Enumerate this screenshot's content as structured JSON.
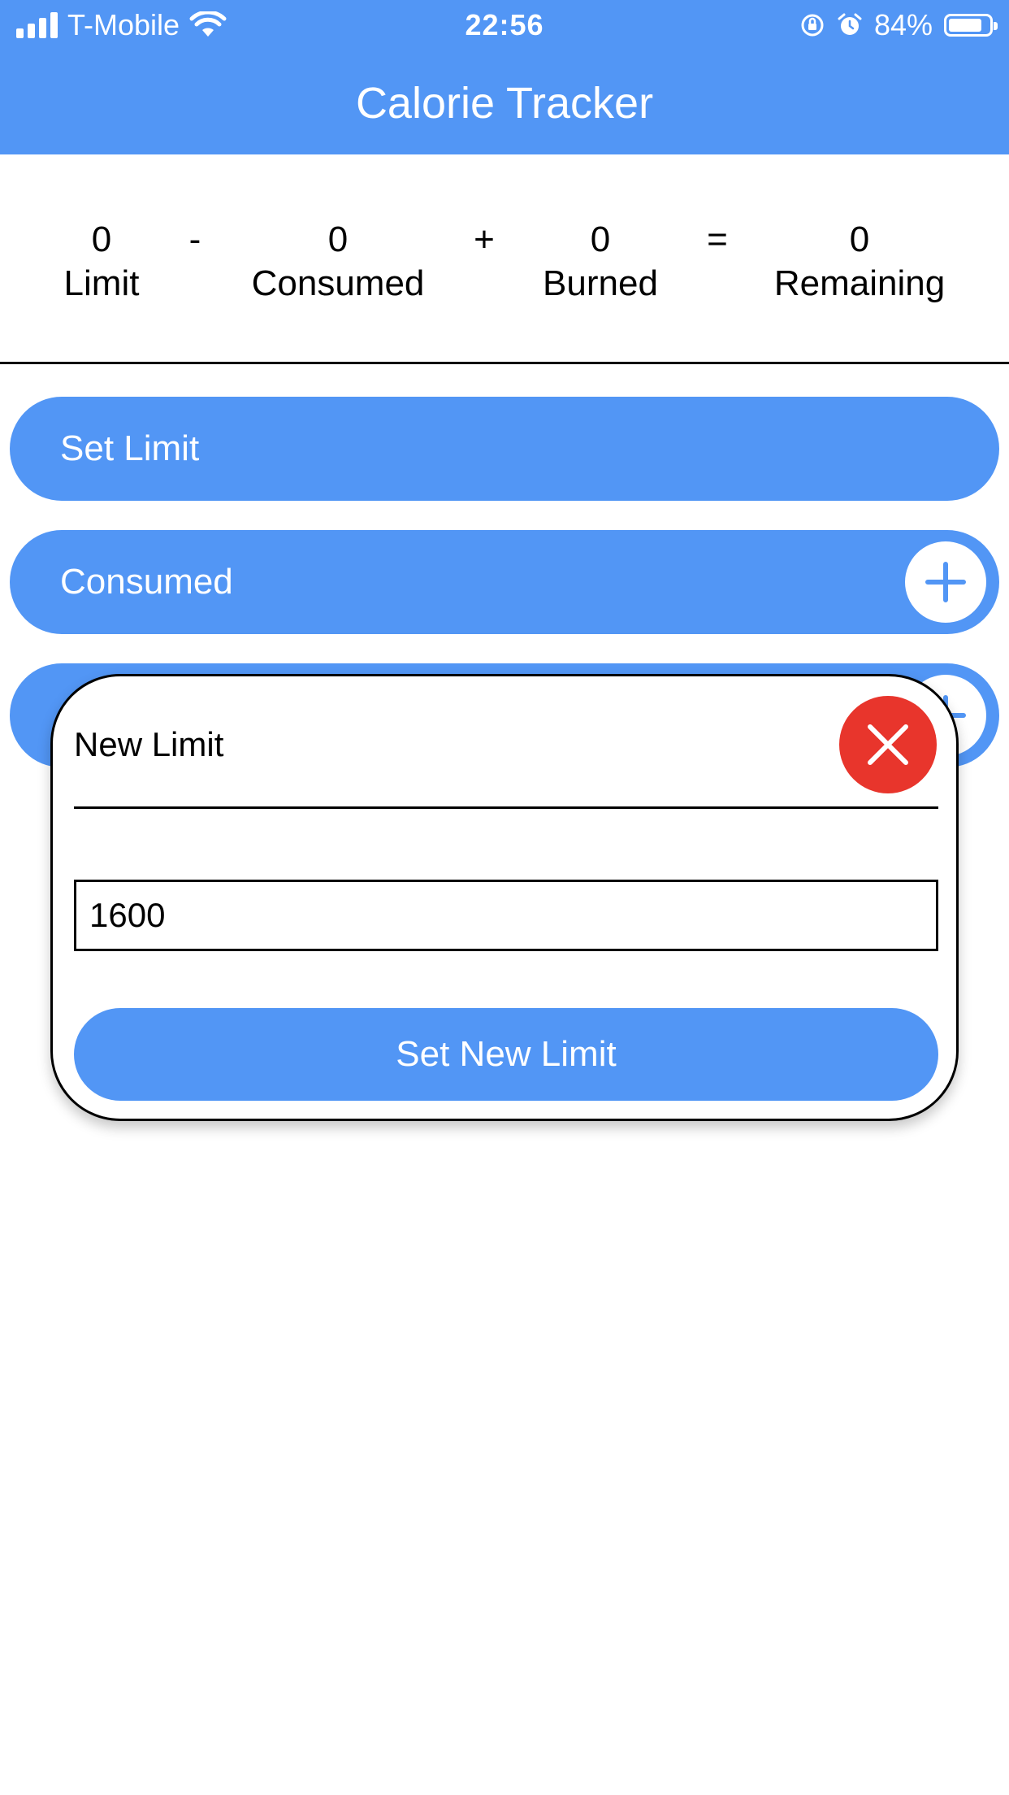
{
  "status_bar": {
    "carrier": "T-Mobile",
    "time": "22:56",
    "battery": "84%",
    "battery_level": 0.84,
    "icons": [
      "signal-icon",
      "wifi-icon",
      "orientation-lock-icon",
      "alarm-icon",
      "battery-icon"
    ]
  },
  "header": {
    "title": "Calorie Tracker"
  },
  "summary": {
    "limit": {
      "value": "0",
      "label": "Limit"
    },
    "minus": "-",
    "consumed": {
      "value": "0",
      "label": "Consumed"
    },
    "plus": "+",
    "burned": {
      "value": "0",
      "label": "Burned"
    },
    "equals": "=",
    "remaining": {
      "value": "0",
      "label": "Remaining"
    }
  },
  "actions": {
    "set_limit": "Set Limit",
    "consumed": "Consumed"
  },
  "modal": {
    "title": "New Limit",
    "input_value": "1600",
    "submit_label": "Set New Limit"
  },
  "colors": {
    "accent": "#5296f5",
    "close": "#e8352c",
    "white": "#ffffff"
  }
}
